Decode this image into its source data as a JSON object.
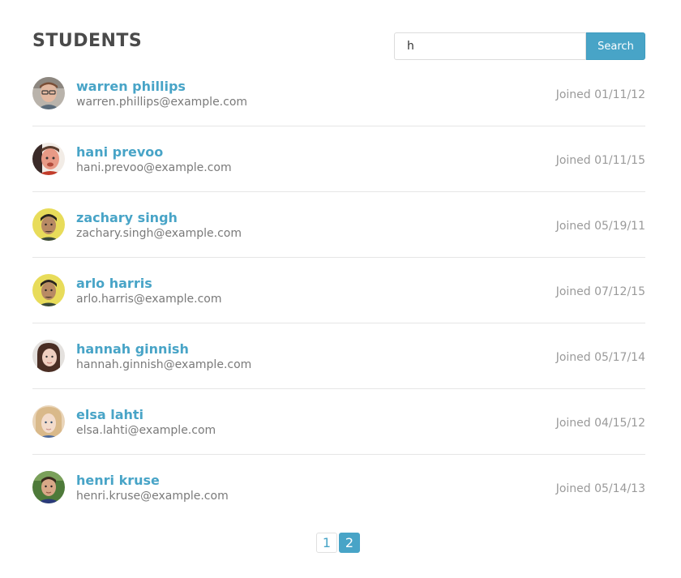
{
  "header": {
    "title": "STUDENTS"
  },
  "search": {
    "value": "h",
    "button_label": "Search"
  },
  "students": [
    {
      "name": "warren phillips",
      "email": "warren.phillips@example.com",
      "joined": "Joined 01/11/12",
      "avatar": "avatar-warren"
    },
    {
      "name": "hani prevoo",
      "email": "hani.prevoo@example.com",
      "joined": "Joined 01/11/15",
      "avatar": "avatar-hani"
    },
    {
      "name": "zachary singh",
      "email": "zachary.singh@example.com",
      "joined": "Joined 05/19/11",
      "avatar": "avatar-zachary"
    },
    {
      "name": "arlo harris",
      "email": "arlo.harris@example.com",
      "joined": "Joined 07/12/15",
      "avatar": "avatar-arlo"
    },
    {
      "name": "hannah ginnish",
      "email": "hannah.ginnish@example.com",
      "joined": "Joined 05/17/14",
      "avatar": "avatar-hannah"
    },
    {
      "name": "elsa lahti",
      "email": "elsa.lahti@example.com",
      "joined": "Joined 04/15/12",
      "avatar": "avatar-elsa"
    },
    {
      "name": "henri kruse",
      "email": "henri.kruse@example.com",
      "joined": "Joined 05/14/13",
      "avatar": "avatar-henri"
    }
  ],
  "pagination": {
    "pages": [
      "1",
      "2"
    ],
    "current": "2"
  },
  "colors": {
    "accent": "#48a4c7",
    "title": "#4a4a4a",
    "muted": "#9a9a9a"
  }
}
